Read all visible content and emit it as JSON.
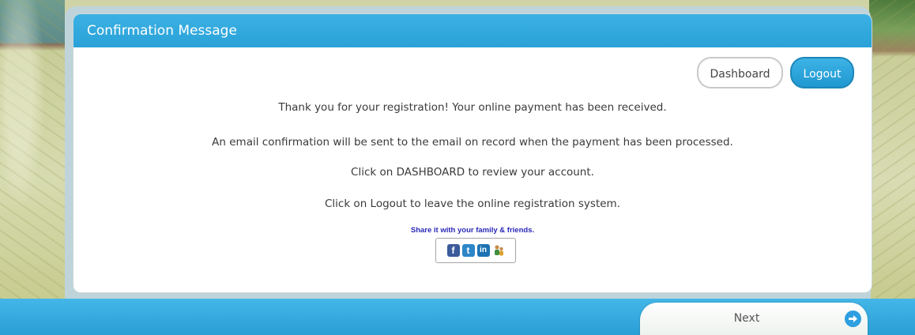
{
  "panel": {
    "title": "Confirmation Message"
  },
  "buttons": {
    "dashboard": "Dashboard",
    "logout": "Logout",
    "next": "Next"
  },
  "messages": [
    "Thank you for your registration! Your online payment has been received.",
    "An email confirmation will be sent to the email on record when the payment has been processed.",
    "Click on DASHBOARD to review your account.",
    "Click on Logout to leave the online registration system."
  ],
  "share": {
    "label": "Share it with your family & friends.",
    "icons": [
      "facebook-icon",
      "twitter-icon",
      "linkedin-icon",
      "share-people-icon"
    ]
  },
  "colors": {
    "accent": "#2aa2d8",
    "share_label": "#2a2ab8"
  }
}
